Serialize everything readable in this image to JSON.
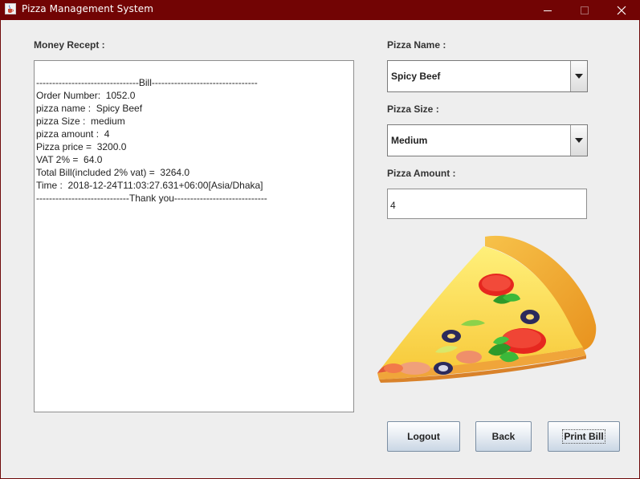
{
  "window": {
    "title": "Pizza Management System"
  },
  "receipt": {
    "label": "Money Recept :",
    "lines": [
      "--------------------------------Bill---------------------------------",
      "Order Number:  1052.0",
      "pizza name :  Spicy Beef",
      "pizza Size :  medium",
      "pizza amount :  4",
      "Pizza price =  3200.0",
      "VAT 2% =  64.0",
      "Total Bill(included 2% vat) =  3264.0",
      "Time :  2018-12-24T11:03:27.631+06:00[Asia/Dhaka]",
      "-----------------------------Thank you-----------------------------"
    ]
  },
  "form": {
    "pizza_name_label": "Pizza Name :",
    "pizza_name_value": "Spicy Beef",
    "pizza_size_label": "Pizza Size :",
    "pizza_size_value": "Medium",
    "pizza_amount_label": "Pizza Amount :",
    "pizza_amount_value": "4"
  },
  "buttons": {
    "logout": "Logout",
    "back": "Back",
    "print_bill": "Print Bill"
  },
  "icons": {
    "app": "java-cup-icon",
    "minimize": "minimize-icon",
    "maximize": "maximize-icon",
    "close": "close-icon",
    "dropdown": "chevron-down-icon"
  },
  "colors": {
    "titlebar": "#720404",
    "background": "#eeeeee"
  }
}
